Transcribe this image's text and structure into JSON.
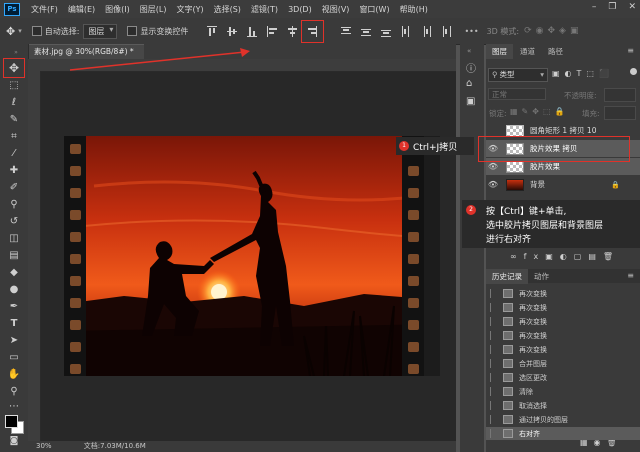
{
  "app": {
    "logo": "Ps"
  },
  "menu": [
    "文件(F)",
    "编辑(E)",
    "图像(I)",
    "图层(L)",
    "文字(Y)",
    "选择(S)",
    "滤镜(T)",
    "3D(D)",
    "视图(V)",
    "窗口(W)",
    "帮助(H)"
  ],
  "window_controls": [
    "–",
    "❐",
    "✕"
  ],
  "options_bar": {
    "auto_select_label": "自动选择:",
    "auto_select_value": "图层",
    "show_transform_label": "显示变换控件",
    "mode_3d_label": "3D 模式:"
  },
  "document_tab": {
    "title": "素材.jpg @ 30%(RGB/8#) *",
    "close": "×"
  },
  "status": {
    "zoom": "30%",
    "doc_info": "文档:7.03M/10.6M"
  },
  "layers_panel": {
    "tabs": [
      "图层",
      "通道",
      "路径"
    ],
    "kind_filter": "类型",
    "blend_mode": "正常",
    "opacity_label": "不透明度:",
    "lock_label": "锁定:",
    "fill_label": "填充:",
    "layers": [
      {
        "name": "圆角矩形 1 拷贝 10",
        "visible": false,
        "selected": false,
        "type": "shape"
      },
      {
        "name": "胶片效果 拷贝",
        "visible": true,
        "selected": true,
        "type": "transparent"
      },
      {
        "name": "胶片效果",
        "visible": true,
        "selected": true,
        "type": "transparent"
      },
      {
        "name": "背景",
        "visible": true,
        "selected": false,
        "type": "image",
        "locked": true
      }
    ]
  },
  "history_panel": {
    "tabs": [
      "历史记录",
      "动作"
    ],
    "items": [
      "再次变换",
      "再次变换",
      "再次变换",
      "再次变换",
      "再次变换",
      "合并图层",
      "选区更改",
      "清除",
      "取消选择",
      "通过拷贝的图层",
      "右对齐"
    ]
  },
  "annotations": {
    "step1": {
      "num": "1",
      "text": "Ctrl+J拷贝"
    },
    "step2": {
      "num": "2",
      "line1": "按【Ctrl】键+单击,",
      "line2": "选中胶片拷贝图层和背景图层",
      "line3": "进行右对齐"
    }
  },
  "colors": {
    "accent_red": "#e0322a",
    "panel_bg": "#3a3a3a",
    "app_bg": "#535353",
    "selected_layer": "#5b5b5b"
  }
}
